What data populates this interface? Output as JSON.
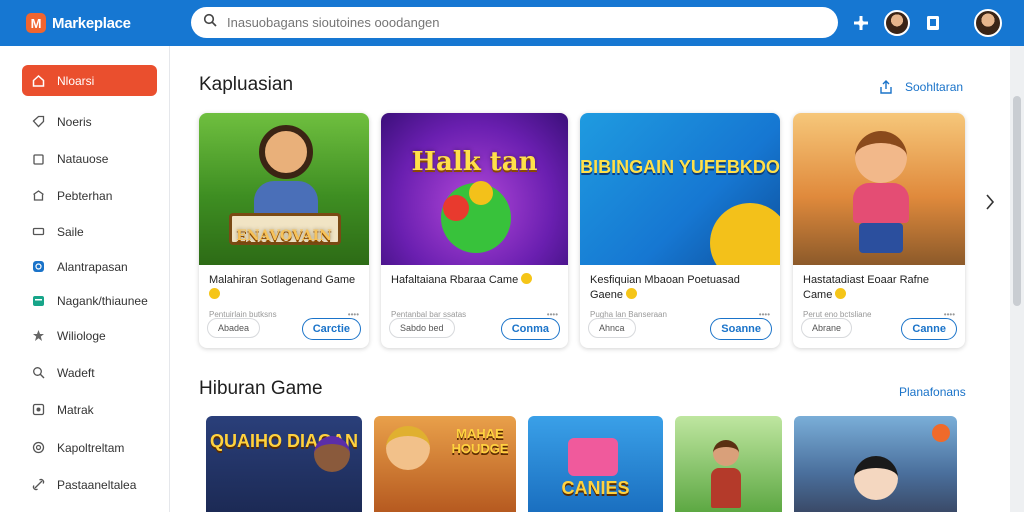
{
  "app": {
    "logo_letter": "M",
    "name": "Markeplace"
  },
  "search": {
    "placeholder": "Inasuobagans sioutoines ooodangen"
  },
  "colors": {
    "topbar": "#1677d2",
    "accent": "#ea4f2e",
    "link": "#1a73c9"
  },
  "header_icons": [
    "add-icon",
    "avatar",
    "bookmark-icon",
    "profile-avatar"
  ],
  "sidebar": {
    "items": [
      {
        "label": "Nloarsi",
        "icon": "home-icon",
        "active": true
      },
      {
        "label": "Noeris",
        "icon": "tag-icon",
        "active": false
      },
      {
        "label": "Natauose",
        "icon": "bag-icon",
        "active": false
      },
      {
        "label": "Pebterhan",
        "icon": "store-icon",
        "active": false
      },
      {
        "label": "Saile",
        "icon": "ticket-icon",
        "active": false
      },
      {
        "label": "Alantrapasan",
        "icon": "circle-icon",
        "active": false
      },
      {
        "label": "Nagank/thiaunee",
        "icon": "wallet-icon",
        "active": false
      },
      {
        "label": "Wiliologe",
        "icon": "star-icon",
        "active": false
      },
      {
        "label": "Wadeft",
        "icon": "search-icon",
        "active": false
      },
      {
        "label": "Matrak",
        "icon": "box-icon",
        "active": false
      },
      {
        "label": "Kapoltreltam",
        "icon": "chat-icon",
        "active": false
      },
      {
        "label": "Pastaaneltalea",
        "icon": "link-icon",
        "active": false
      }
    ]
  },
  "section1": {
    "title": "Kapluasian",
    "link": "Soohltaran",
    "cards": [
      {
        "thumb_text": "ENAVOVAIN",
        "title": "Malahiran Sotlagenand Game",
        "meta": "Pentuirlain butksns",
        "meta_dots": "••••",
        "ghost": "Abadea",
        "primary": "Carctie"
      },
      {
        "thumb_text": "Halk tan",
        "title": "Hafaltaiana Rbaraa Came",
        "meta": "Pentanbal bar ssatas",
        "meta_dots": "••••",
        "ghost": "Sabdo bed",
        "primary": "Conma"
      },
      {
        "thumb_text": "BIBINGAIN YUFEBKDO",
        "title": "Kesfiquian Mbaoan Poetuasad Gaene",
        "meta": "Pugha lan Banseraan",
        "meta_dots": "••••",
        "ghost": "Ahnca",
        "primary": "Soanne"
      },
      {
        "thumb_text": "",
        "title": "Hastatadiast Eoaar Rafne Came",
        "meta": "Perut eno bctsliane",
        "meta_dots": "••••",
        "ghost": "Abrane",
        "primary": "Canne"
      }
    ]
  },
  "section2": {
    "title": "Hiburan Game",
    "link": "Planafonans",
    "tiles": [
      {
        "text": "QUAIHO DIAGAN"
      },
      {
        "text": "MAHAE HOUDGE"
      },
      {
        "text": "CANIES"
      },
      {
        "text": ""
      },
      {
        "text": ""
      }
    ]
  }
}
